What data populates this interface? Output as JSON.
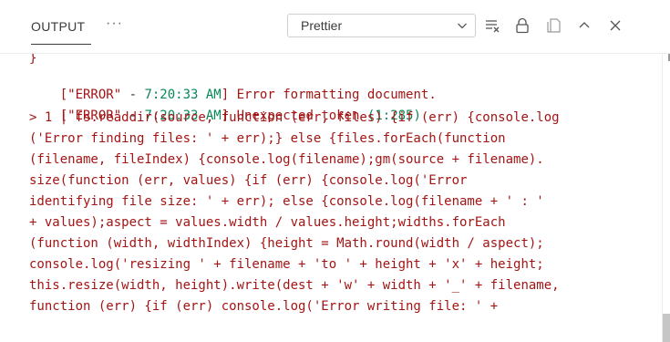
{
  "header": {
    "tab_label": "OUTPUT",
    "more_label": "···",
    "channel_select": {
      "selected": "Prettier"
    }
  },
  "icons": {
    "chevron": "chevron-down-icon",
    "clear": "clear-output-icon",
    "lock": "lock-icon",
    "copy": "open-in-editor-icon",
    "maximize": "chevron-up-icon",
    "close": "close-icon"
  },
  "colors": {
    "error_red": "#a31515",
    "timestamp_green": "#098658",
    "text": "#333333"
  },
  "output": {
    "partial_top": "}",
    "log": [
      {
        "level": "[\"ERROR\"",
        "sep": " - ",
        "time": "7:20:33 AM",
        "close": "]",
        "message": " Error formatting document."
      },
      {
        "level": "[\"ERROR\"",
        "sep": " - ",
        "time": "7:20:33 AM",
        "close": "]",
        "message": " Unexpected token ",
        "loc": "(1:285)"
      }
    ],
    "code_lines": [
      "> 1 | fs.readdir(source, function (err, files) {if (err) {console.log",
      "('Error finding files: ' + err);} else {files.forEach(function",
      "(filename, fileIndex) {console.log(filename);gm(source + filename).",
      "size(function (err, values) {if (err) {console.log('Error",
      "identifying file size: ' + err); else {console.log(filename + ' : '",
      "+ values);aspect = values.width / values.height;widths.forEach",
      "(function (width, widthIndex) {height = Math.round(width / aspect);",
      "console.log('resizing ' + filename + 'to ' + height + 'x' + height;",
      "this.resize(width, height).write(dest + 'w' + width + '_' + filename,",
      "function (err) {if (err) console.log('Error writing file: ' +"
    ]
  }
}
